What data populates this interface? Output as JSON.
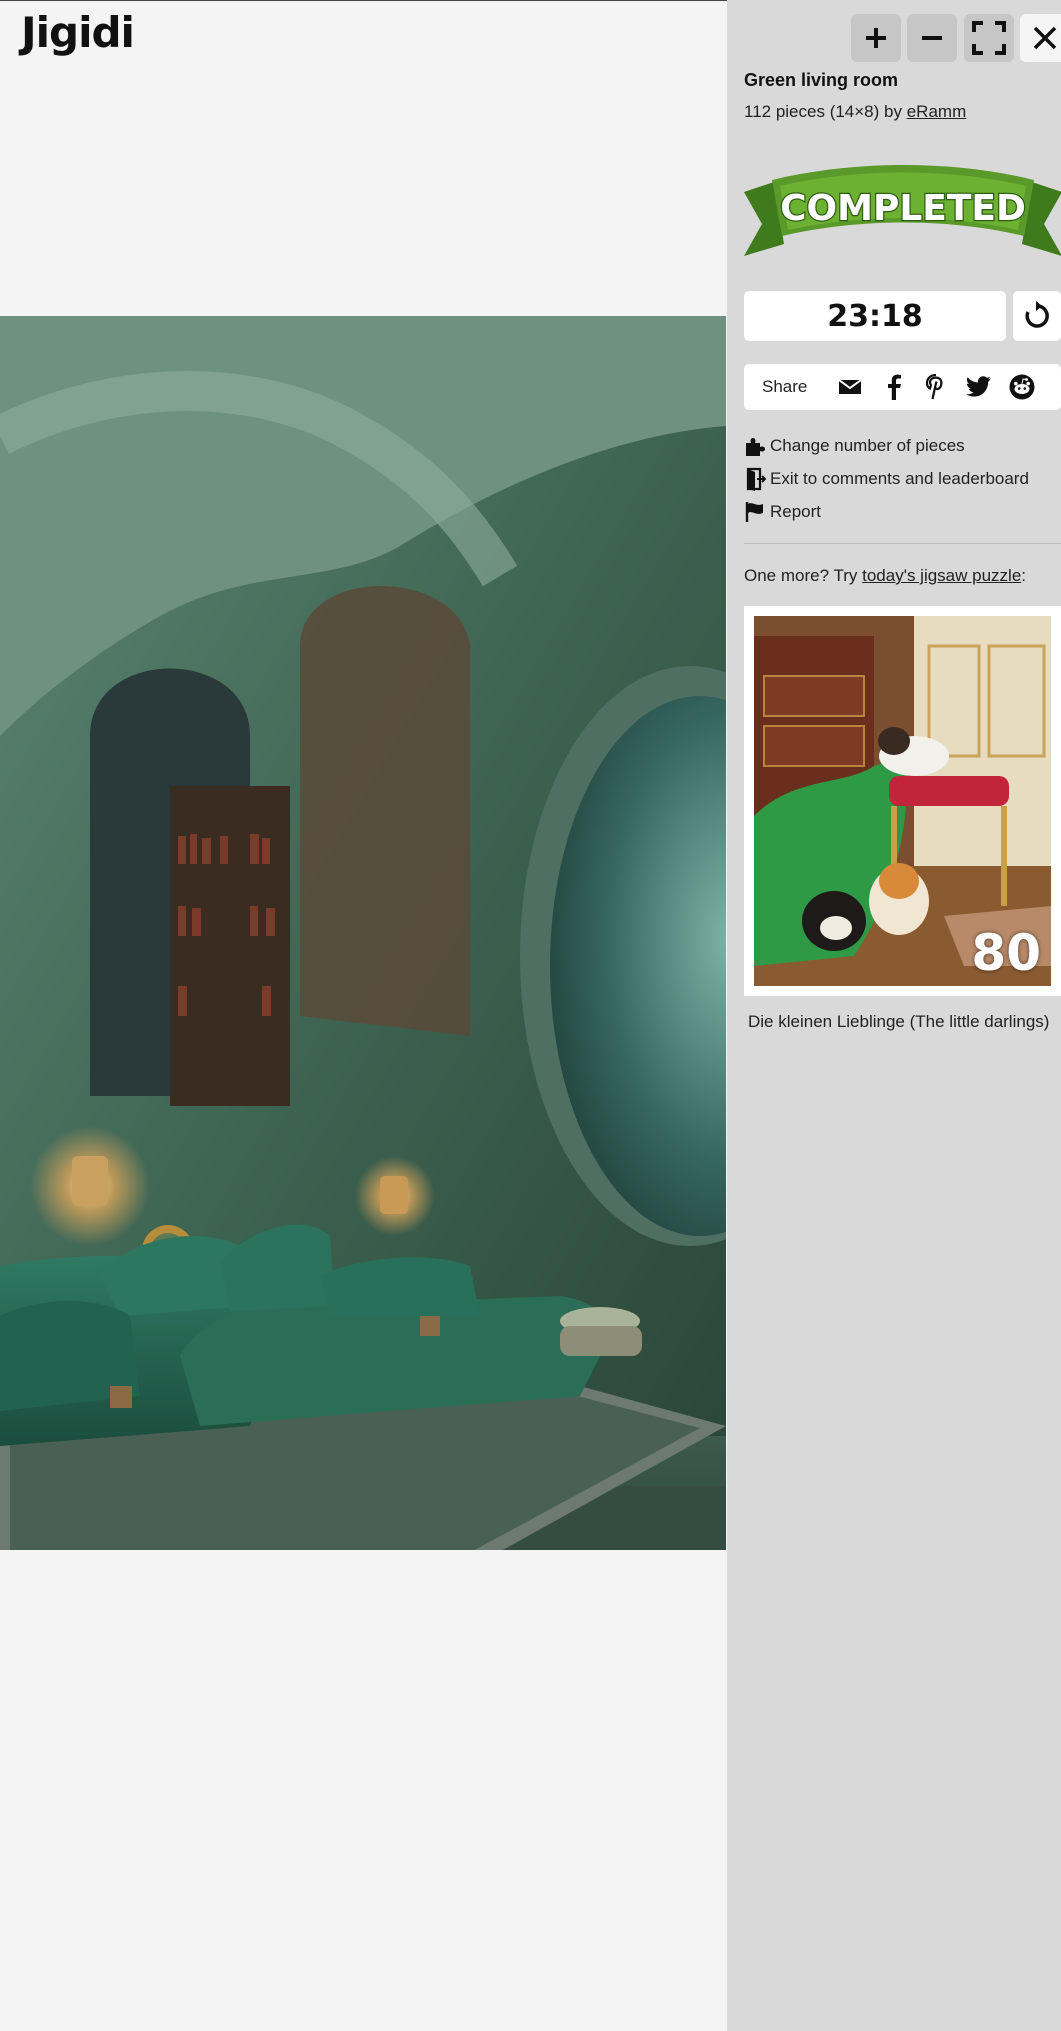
{
  "app": {
    "logo": "Jigidi"
  },
  "controls": [
    {
      "name": "zoom-in-button",
      "icon": "plus-icon"
    },
    {
      "name": "zoom-out-button",
      "icon": "minus-icon"
    },
    {
      "name": "fullscreen-button",
      "icon": "fullscreen-icon"
    },
    {
      "name": "close-button",
      "icon": "close-icon"
    }
  ],
  "puzzle": {
    "title": "Green living room",
    "meta_prefix": "112 pieces (14×8) by ",
    "author": "eRamm",
    "status_banner": "COMPLETED",
    "timer": "23:18"
  },
  "share": {
    "label": "Share",
    "icons": [
      "email-icon",
      "facebook-icon",
      "pinterest-icon",
      "twitter-icon",
      "reddit-icon"
    ]
  },
  "menu": {
    "change_pieces": "Change number of pieces",
    "exit_comments": "Exit to comments and leaderboard",
    "report": "Report"
  },
  "next": {
    "prefix": "One more? Try ",
    "link": "today's jigsaw puzzle",
    "suffix": ":",
    "piece_count": "80",
    "caption": "Die kleinen Lieblinge (The little darlings)"
  },
  "colors": {
    "sidebar_bg": "#d9d9d9",
    "banner_green": "#5a9a2a",
    "page_bg": "#f4f4f4"
  }
}
